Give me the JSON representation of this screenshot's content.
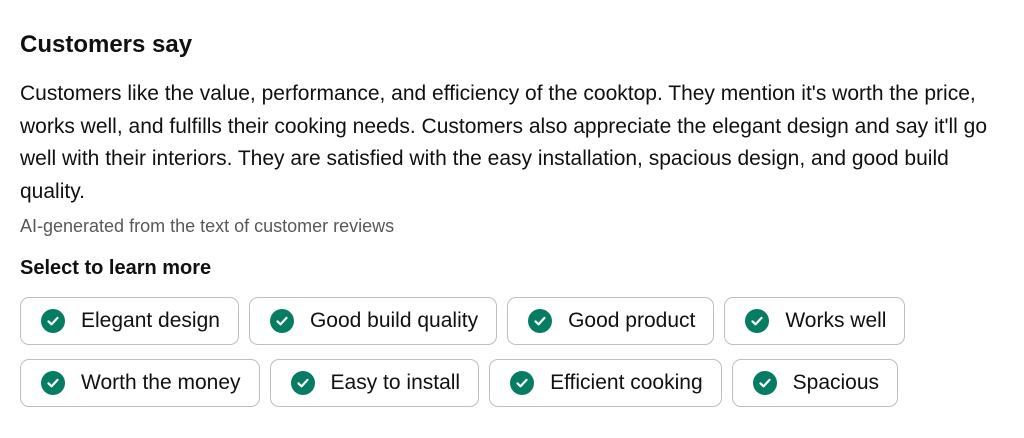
{
  "section": {
    "title": "Customers say",
    "summary": "Customers like the value, performance, and efficiency of the cooktop. They mention it's worth the price, works well, and fulfills their cooking needs. Customers also appreciate the elegant design and say it'll go well with their interiors. They are satisfied with the easy installation, spacious design, and good build quality.",
    "ai_note": "AI-generated from the text of customer reviews",
    "select_heading": "Select to learn more"
  },
  "chips": {
    "row1": [
      {
        "label": "Elegant design",
        "icon": "check-circle-icon"
      },
      {
        "label": "Good build quality",
        "icon": "check-circle-icon"
      },
      {
        "label": "Good product",
        "icon": "check-circle-icon"
      },
      {
        "label": "Works well",
        "icon": "check-circle-icon"
      }
    ],
    "row2": [
      {
        "label": "Worth the money",
        "icon": "check-circle-icon"
      },
      {
        "label": "Easy to install",
        "icon": "check-circle-icon"
      },
      {
        "label": "Efficient cooking",
        "icon": "check-circle-icon"
      },
      {
        "label": "Spacious",
        "icon": "check-circle-icon"
      }
    ]
  },
  "colors": {
    "positive_icon": "#067d62",
    "text": "#0f1111",
    "muted_text": "#565959",
    "chip_border": "#bbbfbf"
  }
}
